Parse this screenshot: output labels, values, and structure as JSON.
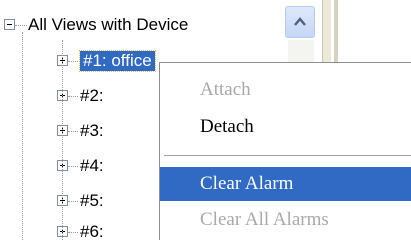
{
  "tree": {
    "root_label": "All Views with Device",
    "root_expander": "minus",
    "children": [
      {
        "label": "#1: office",
        "selected": true,
        "expander": "plus"
      },
      {
        "label": "#2:",
        "selected": false,
        "expander": "plus"
      },
      {
        "label": "#3:",
        "selected": false,
        "expander": "plus"
      },
      {
        "label": "#4:",
        "selected": false,
        "expander": "plus"
      },
      {
        "label": "#5:",
        "selected": false,
        "expander": "plus"
      },
      {
        "label": "#6:",
        "selected": false,
        "expander": "plus"
      }
    ]
  },
  "scrollbar": {
    "up_icon": "chevron-up-icon"
  },
  "context_menu": {
    "items": [
      {
        "label": "Attach",
        "enabled": false,
        "highlighted": false
      },
      {
        "label": "Detach",
        "enabled": true,
        "highlighted": false
      },
      {
        "label": "Clear Alarm",
        "enabled": true,
        "highlighted": true
      },
      {
        "label": "Clear All Alarms",
        "enabled": false,
        "highlighted": false
      }
    ]
  },
  "colors": {
    "selection": "#316ac5",
    "disabled_text": "#a9a9a9",
    "tree_lines": "#9a9a9a"
  }
}
